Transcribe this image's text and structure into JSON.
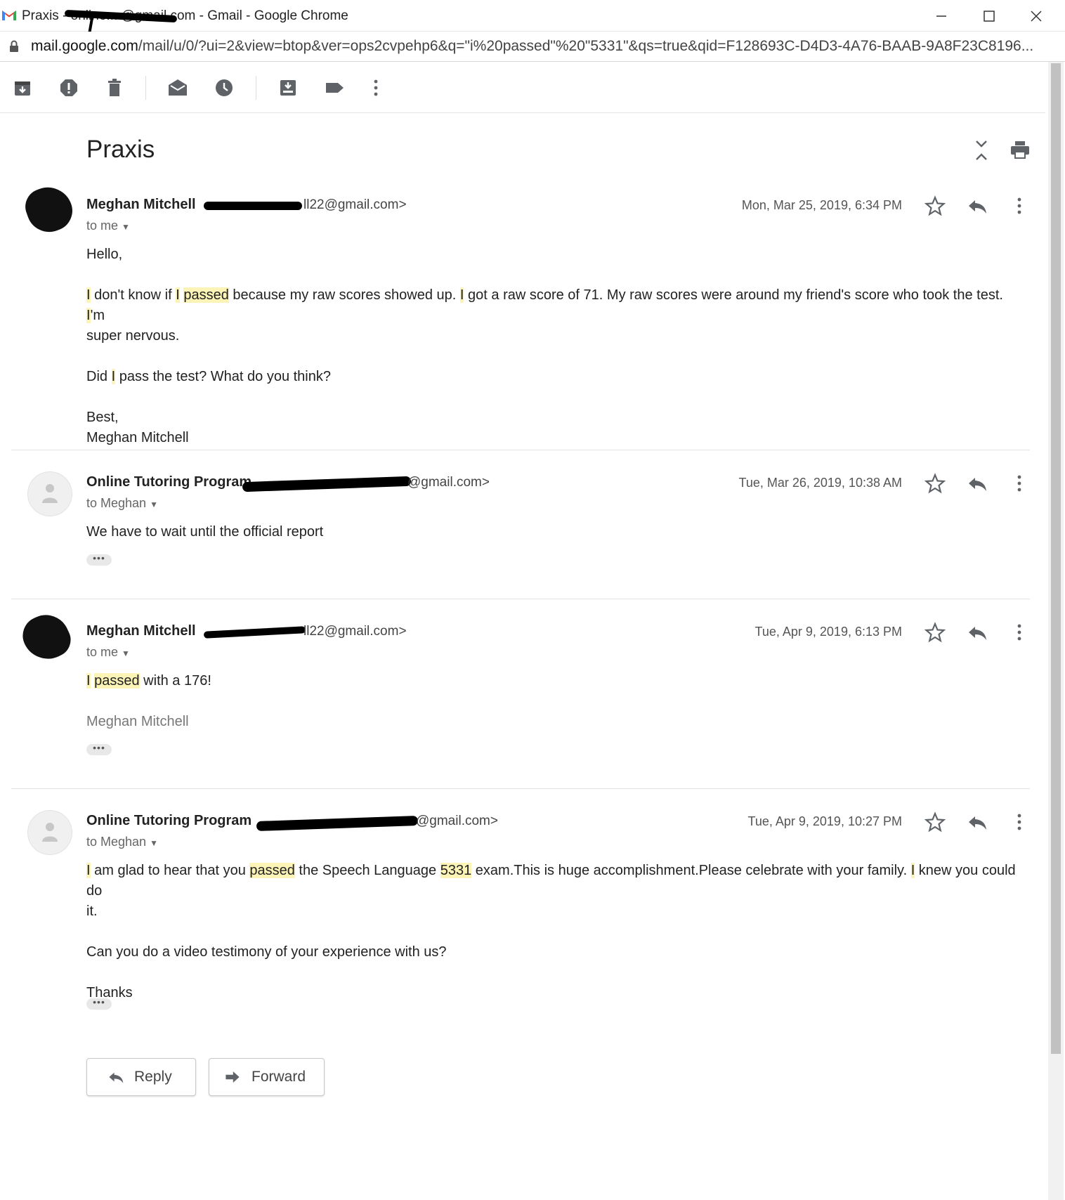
{
  "window": {
    "title": "Praxis - online... @gmail.com - Gmail - Google Chrome",
    "url_host": "mail.google.com",
    "url_path": "/mail/u/0/?ui=2&view=btop&ver=ops2cvpehp6&q=\"i%20passed\"%20\"5331\"&qs=true&qid=F128693C-D4D3-4A76-BAAB-9A8F23C8196..."
  },
  "thread": {
    "subject": "Praxis",
    "messages": [
      {
        "sender": "Meghan Mitchell",
        "email_visible": "ll22@gmail.com>",
        "date": "Mon, Mar 25, 2019, 6:34 PM",
        "recipient": "to me",
        "body": {
          "greeting": "Hello,",
          "p1_a": "I",
          "p1_b": " don't know if ",
          "p1_c": "I",
          "p1_d": " ",
          "p1_e": "passed",
          "p1_f": " because my raw scores showed up. ",
          "p1_g": "I",
          "p1_h": " got a raw score of 71. My raw scores were around my friend's score who took the test. ",
          "p1_i": "I",
          "p1_j": "'m",
          "p1_k": "super nervous.",
          "p2_a": "Did ",
          "p2_b": "I",
          "p2_c": " pass the test? What do you think?",
          "closing": "Best,",
          "signature": "Meghan Mitchell"
        }
      },
      {
        "sender": "Online Tutoring Program",
        "email_visible": "@gmail.com>",
        "date": "Tue, Mar 26, 2019, 10:38 AM",
        "recipient": "to Meghan",
        "body": {
          "p1": "We have to wait until the official report"
        }
      },
      {
        "sender": "Meghan Mitchell",
        "email_visible": "ll22@gmail.com>",
        "date": "Tue, Apr 9, 2019, 6:13 PM",
        "recipient": "to me",
        "body": {
          "p1_a": "I",
          "p1_b": " ",
          "p1_c": "passed",
          "p1_d": " with a 176!",
          "signature": "Meghan Mitchell"
        }
      },
      {
        "sender": "Online Tutoring Program",
        "email_visible": "@gmail.com>",
        "date": "Tue, Apr 9, 2019, 10:27 PM",
        "recipient": "to Meghan",
        "body": {
          "p1_a": "I",
          "p1_b": " am glad to hear that you ",
          "p1_c": "passed",
          "p1_d": " the Speech Language ",
          "p1_e": "5331",
          "p1_f": " exam.This is huge accomplishment.Please celebrate with your family. ",
          "p1_g": "I",
          "p1_h": " knew you could do",
          "p1_i": "it.",
          "p2": "Can you do a video testimony of your experience with us?",
          "p3": "Thanks"
        }
      }
    ]
  },
  "actions": {
    "reply": "Reply",
    "forward": "Forward",
    "ellipsis": "•••"
  },
  "icons": [
    "gmail-logo-icon",
    "lock-icon",
    "archive-icon",
    "report-spam-icon",
    "delete-icon",
    "mark-unread-icon",
    "snooze-icon",
    "move-to-icon",
    "label-icon",
    "more-vert-icon",
    "expand-collapse-icon",
    "print-icon",
    "star-icon",
    "reply-icon",
    "forward-icon",
    "minimize-icon",
    "maximize-icon",
    "close-icon"
  ],
  "colors": {
    "highlight": "#fcf3b6",
    "text": "#222222"
  }
}
